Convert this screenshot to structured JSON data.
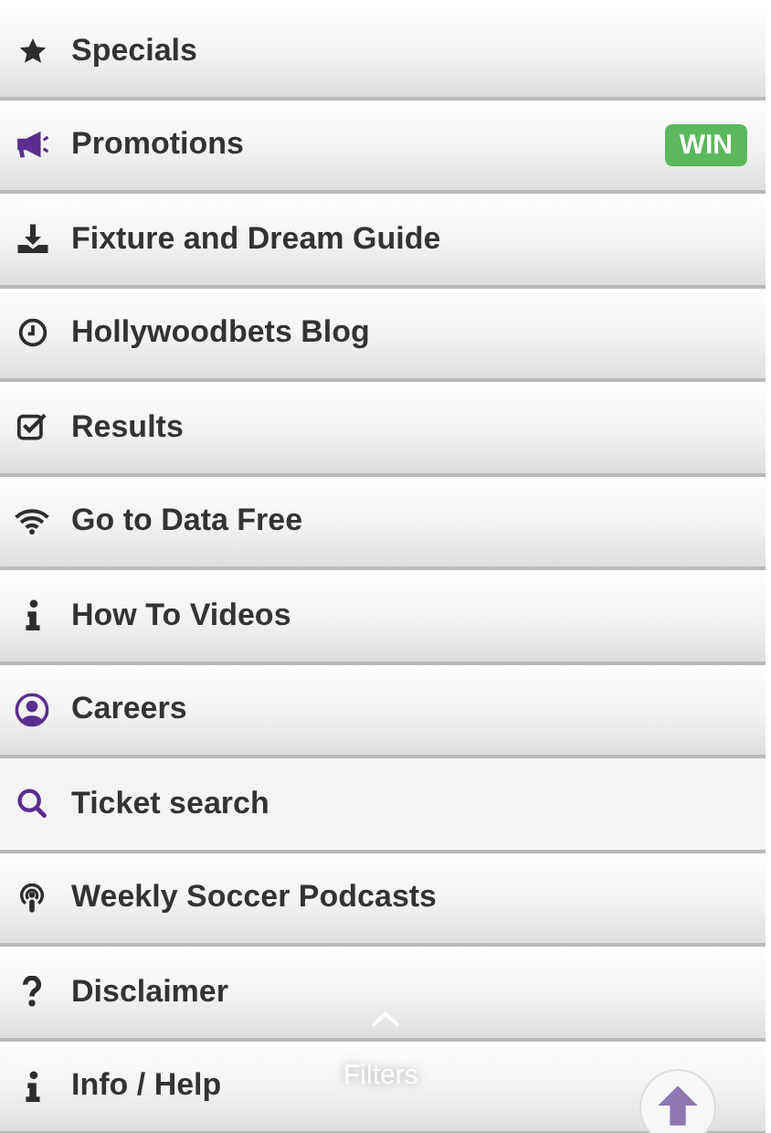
{
  "menu": [
    {
      "label": "Specials",
      "kind": "star",
      "selected": false
    },
    {
      "label": "Promotions",
      "kind": "megaphone",
      "selected": false,
      "badge": "WIN"
    },
    {
      "label": "Fixture and Dream Guide",
      "kind": "download",
      "selected": false
    },
    {
      "label": "Hollywoodbets Blog",
      "kind": "clock",
      "selected": false
    },
    {
      "label": "Results",
      "kind": "checkbox",
      "selected": false
    },
    {
      "label": "Go to Data Free",
      "kind": "wifi",
      "selected": false
    },
    {
      "label": "How To Videos",
      "kind": "info",
      "selected": false
    },
    {
      "label": "Careers",
      "kind": "user",
      "selected": false
    },
    {
      "label": "Ticket search",
      "kind": "search",
      "selected": true
    },
    {
      "label": "Weekly Soccer Podcasts",
      "kind": "podcast",
      "selected": false
    },
    {
      "label": "Disclaimer",
      "kind": "question",
      "selected": false
    },
    {
      "label": "Info / Help",
      "kind": "info",
      "selected": false
    }
  ],
  "filters": {
    "label": "Filters"
  }
}
